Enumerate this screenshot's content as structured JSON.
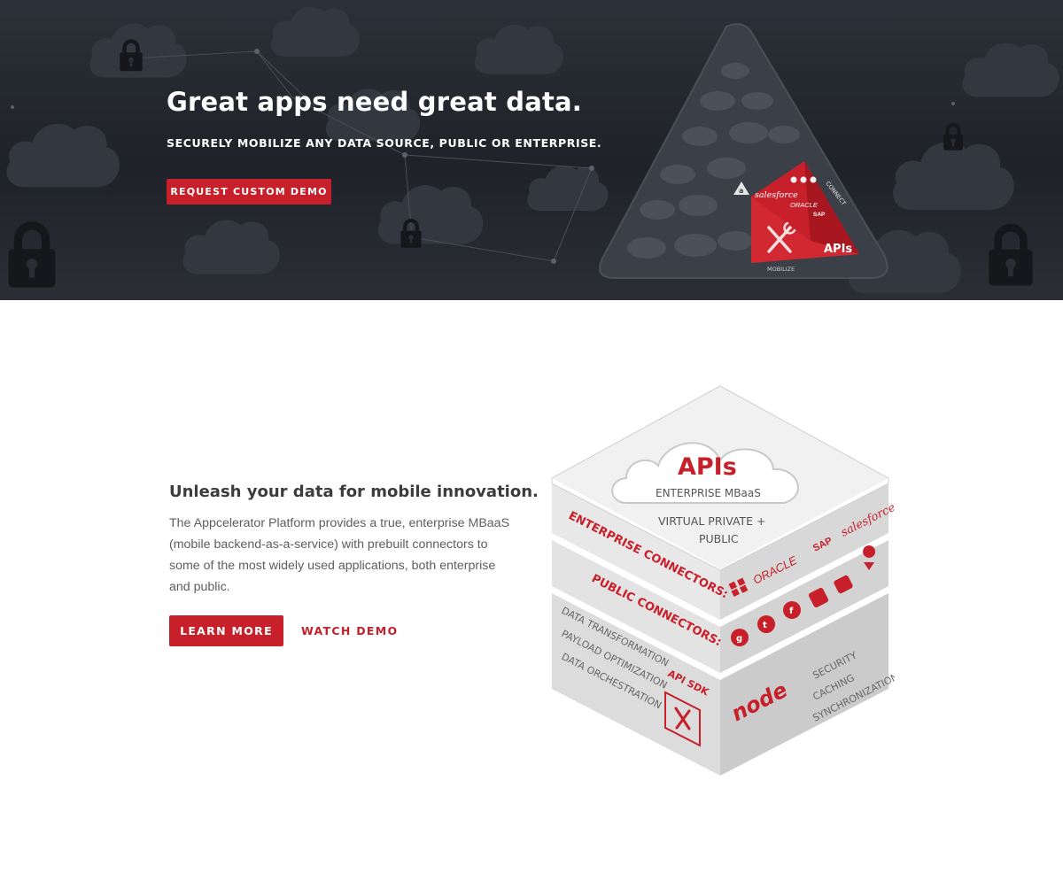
{
  "hero": {
    "title": "Great apps need great data.",
    "subtitle": "SECURELY MOBILIZE ANY DATA SOURCE, PUBLIC OR ENTERPRISE.",
    "cta_label": "REQUEST CUSTOM DEMO",
    "art": {
      "connect_label": "CONNECT",
      "mobilize_label": "MOBILIZE",
      "apis_label": "APIs",
      "salesforce_label": "salesforce",
      "oracle_label": "ORACLE",
      "sap_label": "SAP",
      "logo_letter": "a"
    }
  },
  "content": {
    "title": "Unleash your data for mobile innovation.",
    "body": "The Appcelerator Platform provides a true, enterprise MBaaS (mobile backend-as-a-service) with prebuilt connectors to some of the most widely used applications, both enterprise and public.",
    "learn_more_label": "LEARN MORE",
    "watch_demo_label": "WATCH DEMO"
  },
  "cube": {
    "apis_label": "APIs",
    "enterprise_mbaas_label": "ENTERPRISE MBaaS",
    "virtual_private_label": "VIRTUAL PRIVATE +",
    "public_label": "PUBLIC",
    "enterprise_connectors_label": "ENTERPRISE CONNECTORS:",
    "public_connectors_label": "PUBLIC CONNECTORS:",
    "oracle_label": "ORACLE",
    "sap_label": "SAP",
    "salesforce_label": "salesforce",
    "data_transformation_label": "DATA TRANSFORMATION",
    "payload_optimization_label": "PAYLOAD OPTIMIZATION",
    "data_orchestration_label": "DATA ORCHESTRATION",
    "api_sdk_label": "API SDK",
    "node_label": "node",
    "security_label": "SECURITY",
    "caching_label": "CACHING",
    "synchronization_label": "SYNCHRONIZATION"
  },
  "colors": {
    "accent": "#c7202b",
    "hero_bg": "#22252b",
    "body_text": "#5e5e5e",
    "heading_text": "#3c3c3c"
  }
}
